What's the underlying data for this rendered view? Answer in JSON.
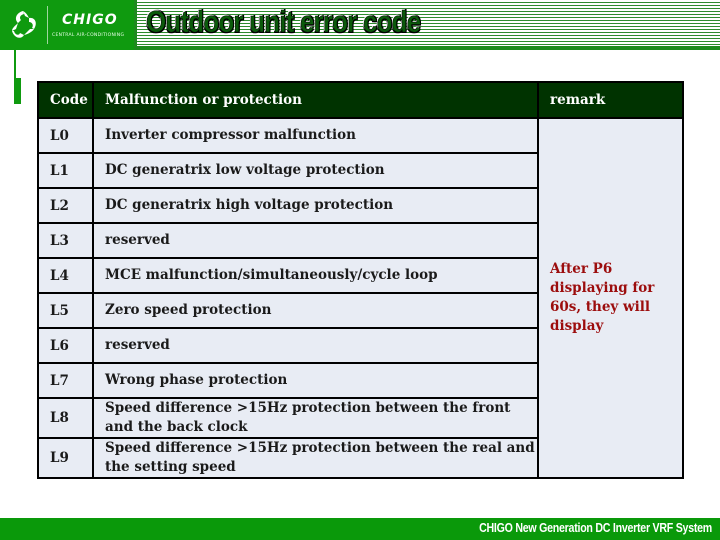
{
  "header": {
    "logo_icon": "chigo-swirl-logo-icon",
    "brand": "CHIGO",
    "brand_subtitle": "CENTRAL AIR-CONDITIONING",
    "title": "Outdoor unit error code"
  },
  "table": {
    "columns": [
      "Code",
      "Malfunction or protection",
      "remark"
    ],
    "rows": [
      {
        "code": "L0",
        "desc": "Inverter compressor malfunction"
      },
      {
        "code": "L1",
        "desc": "DC generatrix low voltage protection"
      },
      {
        "code": "L2",
        "desc": "DC generatrix high voltage protection"
      },
      {
        "code": "L3",
        "desc": "reserved"
      },
      {
        "code": "L4",
        "desc": "MCE malfunction/simultaneously/cycle loop"
      },
      {
        "code": "L5",
        "desc": "Zero speed protection"
      },
      {
        "code": "L6",
        "desc": "reserved"
      },
      {
        "code": "L7",
        "desc": "Wrong phase protection"
      },
      {
        "code": "L8",
        "desc": "Speed difference >15Hz protection between the front and the back clock"
      },
      {
        "code": "L9",
        "desc": "Speed difference >15Hz protection between the real and the setting speed"
      }
    ],
    "remark": "After P6 displaying  for 60s, they will display",
    "remark_color": "#9c0d0d",
    "header_color": "#003300"
  },
  "footer": {
    "text": "CHIGO New Generation DC Inverter VRF System"
  },
  "colors": {
    "brand_green": "#0f9a0f",
    "cell_bg": "#e8ecf4"
  }
}
